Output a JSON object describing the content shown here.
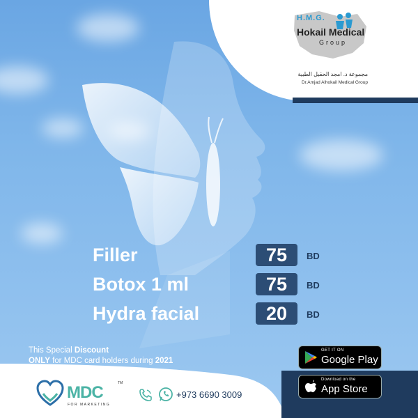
{
  "brand": {
    "logo_abbrev": "H.M.G.",
    "logo_name": "Hokail Medical",
    "logo_group": "Group",
    "arabic_name": "مجموعة د. امجد الحقيل الطبية",
    "english_subname": "Dr.Amjad Alhokail Medical Group"
  },
  "offers": [
    {
      "name": "Filler",
      "price": "75",
      "currency": "BD"
    },
    {
      "name": "Botox 1 ml",
      "price": "75",
      "currency": "BD"
    },
    {
      "name": "Hydra facial",
      "price": "20",
      "currency": "BD"
    }
  ],
  "promo": {
    "l1_part1": "This Special ",
    "l1_bold": "Discount",
    "l2_bold1": "ONLY",
    "l2_part": " for MDC card holders during ",
    "l2_bold2": "2021"
  },
  "stores": {
    "google_small": "GET IT ON",
    "google_big": "Google Play",
    "apple_small": "Download on the",
    "apple_big": "App Store"
  },
  "footer": {
    "mdc_name": "MDC",
    "mdc_tm": "TM",
    "mdc_sub": "FOR MARKETING",
    "phone": "+973 6690 3009"
  },
  "icons": {
    "phone": "phone-icon",
    "whatsapp": "whatsapp-icon",
    "google_play": "google-play-icon",
    "apple": "apple-icon",
    "mdc_heart": "heart-hands-icon"
  },
  "colors": {
    "sky": "#7fb6ea",
    "navy": "#1f3b5e",
    "price_box": "#2c4d75",
    "mdc_teal": "#4bb3a5"
  }
}
